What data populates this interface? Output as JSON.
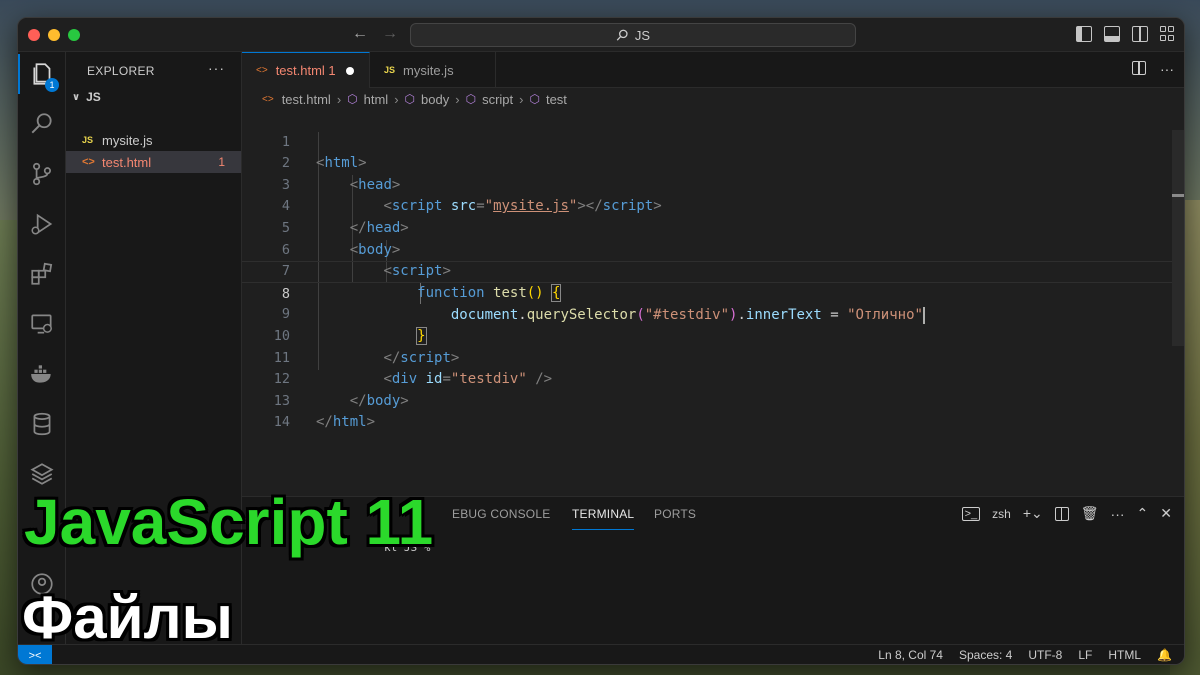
{
  "titlebar": {
    "search": "JS"
  },
  "sidebar": {
    "header": "EXPLORER",
    "folder": "JS",
    "files": [
      {
        "icon": "JS",
        "name": "mysite.js"
      },
      {
        "icon": "<>",
        "name": "test.html",
        "problems": "1"
      }
    ]
  },
  "activity": {
    "explorer_badge": "1"
  },
  "tabs": [
    {
      "icon": "<>",
      "label": "test.html 1",
      "modified": true
    },
    {
      "icon": "JS",
      "label": "mysite.js"
    }
  ],
  "breadcrumb": [
    "test.html",
    "html",
    "body",
    "script",
    "test"
  ],
  "editor": {
    "line_numbers": [
      "1",
      "2",
      "3",
      "4",
      "5",
      "6",
      "7",
      "8",
      "9",
      "10",
      "11",
      "12",
      "13",
      "14"
    ],
    "current_line": 8
  },
  "panel": {
    "tabs": [
      "EBUG CONSOLE",
      "TERMINAL",
      "PORTS"
    ],
    "active_tab": "TERMINAL",
    "shell": "zsh",
    "terminal_text": "kl JS %"
  },
  "statusbar": {
    "position": "Ln 8, Col 74",
    "spaces": "Spaces: 4",
    "encoding": "UTF-8",
    "eol": "LF",
    "language": "HTML"
  },
  "overlay": {
    "title": "JavaScript 11",
    "subtitle": "Файлы"
  }
}
